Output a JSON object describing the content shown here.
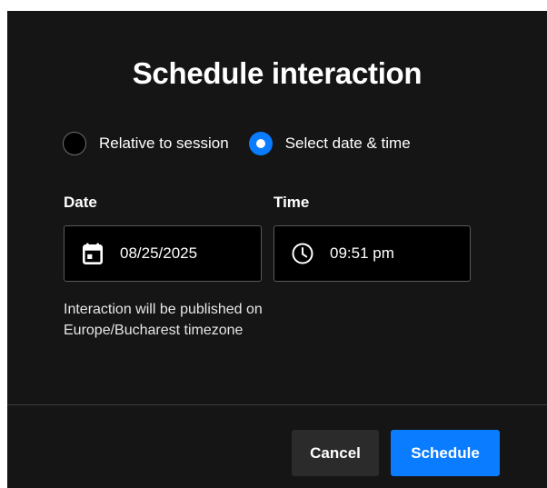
{
  "dialog": {
    "title": "Schedule interaction"
  },
  "mode": {
    "options": [
      {
        "label": "Relative to session",
        "selected": false
      },
      {
        "label": "Select date & time",
        "selected": true
      }
    ]
  },
  "date": {
    "label": "Date",
    "value": "08/25/2025",
    "icon": "calendar-icon"
  },
  "time": {
    "label": "Time",
    "value": "09:51 pm",
    "icon": "clock-icon"
  },
  "hint": {
    "line1": "Interaction will be published on",
    "line2": "Europe/Bucharest timezone"
  },
  "footer": {
    "cancel_label": "Cancel",
    "schedule_label": "Schedule"
  },
  "colors": {
    "dialog_background": "#151515",
    "accent": "#0a7cff",
    "input_background": "#000000",
    "secondary_button": "#2b2b2b"
  }
}
